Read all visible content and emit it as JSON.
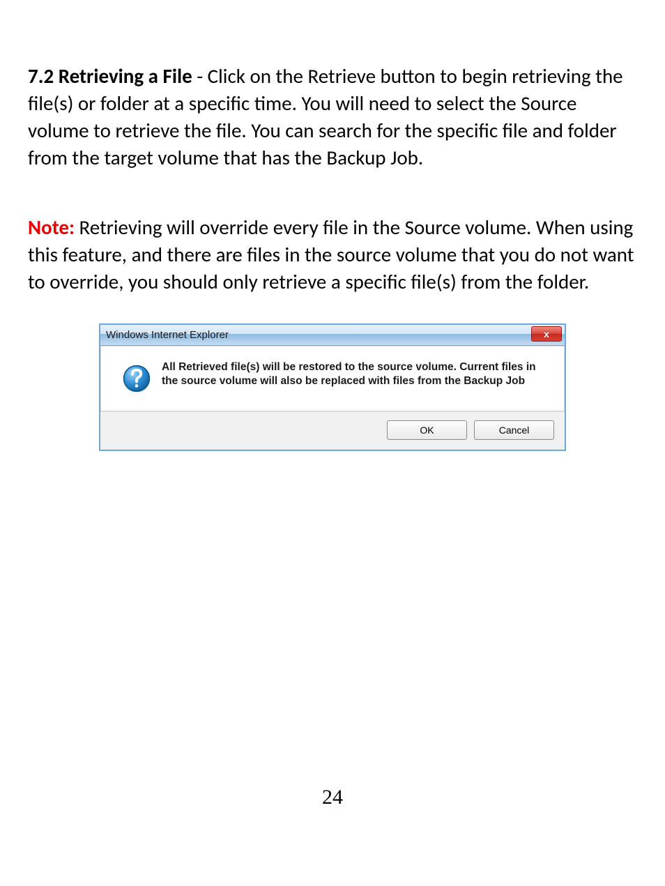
{
  "section": {
    "heading": "7.2 Retrieving a File",
    "body_after_heading": " - Click on the Retrieve button to begin retrieving the file(s) or folder at a specific time. You will need to select the Source volume to retrieve the file. You can search for the specific file and folder from the target volume that has the Backup Job."
  },
  "note": {
    "label": "Note:",
    "body": " Retrieving will override every file in the Source volume. When using this feature, and there are files in the source volume that you do not want to override, you should only retrieve a specific file(s) from the folder."
  },
  "dialog": {
    "title": "Windows Internet Explorer",
    "close_glyph": "x",
    "message": "All Retrieved file(s) will be restored to the source volume. Current files in the source volume will also be replaced with files from the Backup Job",
    "ok_label": "OK",
    "cancel_label": "Cancel"
  },
  "page_number": "24"
}
